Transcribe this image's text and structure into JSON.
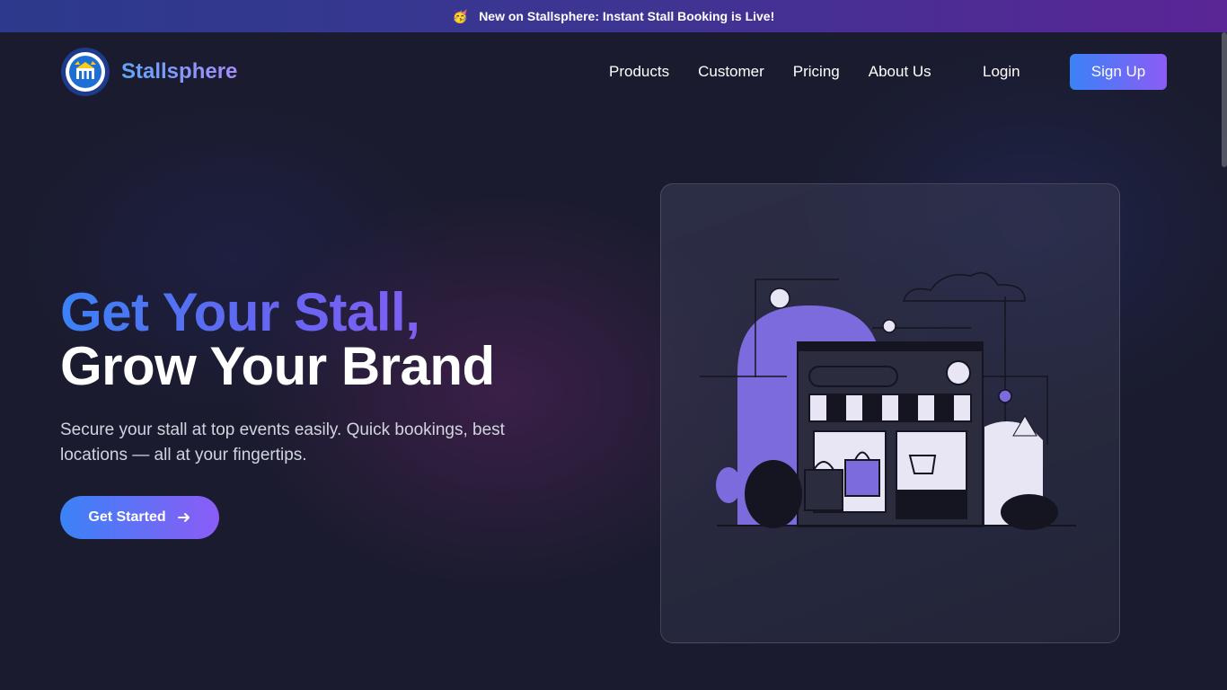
{
  "announcement": {
    "emoji": "🥳",
    "text": "New on Stallsphere: Instant Stall Booking is Live!"
  },
  "brand": {
    "name": "Stallsphere"
  },
  "nav": {
    "links": [
      "Products",
      "Customer",
      "Pricing",
      "About Us"
    ],
    "login": "Login",
    "signup": "Sign Up"
  },
  "hero": {
    "title_line1": "Get Your Stall,",
    "title_line2": "Grow Your Brand",
    "subtitle": "Secure your stall at top events easily. Quick bookings, best locations — all at your fingertips.",
    "cta": "Get Started"
  },
  "colors": {
    "accent_start": "#3b82f6",
    "accent_end": "#8b5cf6",
    "background": "#1a1b2e",
    "illustration_purple": "#7c6bdc"
  },
  "icons": {
    "cta": "arrow-right-icon",
    "logo": "university-seal-logo"
  }
}
